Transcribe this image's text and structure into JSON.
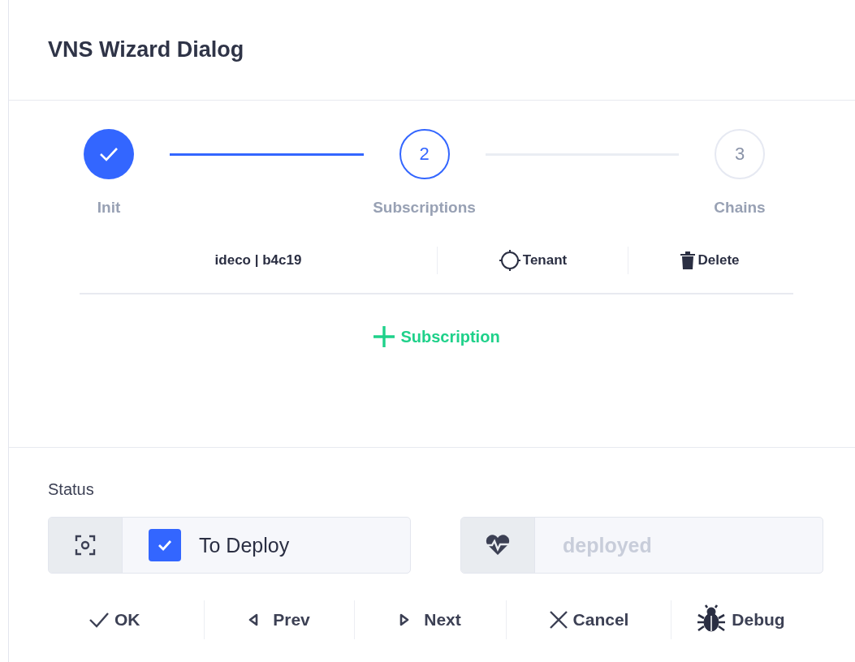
{
  "window": {
    "title": "VNS Wizard Dialog"
  },
  "steps": [
    {
      "label": "Init",
      "kind": "done"
    },
    {
      "label": "Subscriptions",
      "marker": "2",
      "kind": "current"
    },
    {
      "label": "Chains",
      "marker": "3",
      "kind": "pending"
    }
  ],
  "subscriptions": [
    {
      "name": "ideco | b4c19",
      "actions": [
        "Tenant",
        "Delete"
      ]
    }
  ],
  "add_button": "Subscription",
  "status": {
    "label": "Status",
    "checkbox": {
      "label": "To Deploy",
      "checked": true
    },
    "state_field": {
      "value": "deployed",
      "disabled": true
    }
  },
  "buttons": [
    {
      "kind": "ok",
      "label": "OK"
    },
    {
      "kind": "prev",
      "label": "Prev"
    },
    {
      "kind": "next",
      "label": "Next"
    },
    {
      "kind": "cancel",
      "label": "Cancel"
    },
    {
      "kind": "debug",
      "label": "Debug"
    }
  ]
}
